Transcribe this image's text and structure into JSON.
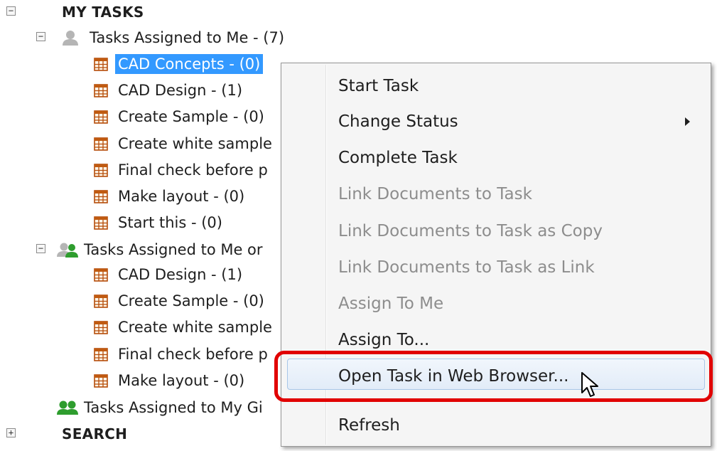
{
  "tree": {
    "my_tasks": {
      "label": "MY TASKS",
      "expander": "−"
    },
    "assigned_to_me": {
      "label": "Tasks Assigned to Me - (7)",
      "expander": "−",
      "items": [
        "CAD Concepts - (0)",
        "CAD Design - (1)",
        "Create Sample - (0)",
        "Create white sample",
        "Final check before p",
        "Make layout - (0)",
        "Start this - (0)"
      ]
    },
    "assigned_to_me_or": {
      "label": "Tasks Assigned to Me or",
      "expander": "−",
      "items": [
        "CAD Design - (1)",
        "Create Sample - (0)",
        "Create white sample",
        "Final check before p",
        "Make layout - (0)"
      ]
    },
    "assigned_to_group": {
      "label": "Tasks Assigned to My Gi"
    },
    "search": {
      "label": "SEARCH",
      "expander": "+"
    }
  },
  "context_menu": {
    "items": [
      {
        "label": "Start Task",
        "enabled": true
      },
      {
        "label": "Change Status",
        "enabled": true,
        "submenu": true
      },
      {
        "label": "Complete Task",
        "enabled": true
      },
      {
        "label": "Link Documents to Task",
        "enabled": false
      },
      {
        "label": "Link Documents to Task as Copy",
        "enabled": false
      },
      {
        "label": "Link Documents to Task as Link",
        "enabled": false
      },
      {
        "label": "Assign To Me",
        "enabled": false
      },
      {
        "label": "Assign To...",
        "enabled": true
      },
      {
        "label": "Open Task in Web Browser...",
        "enabled": true,
        "hovered": true
      },
      {
        "label": "Refresh",
        "enabled": true
      }
    ]
  },
  "colors": {
    "selection": "#3399ff",
    "highlight_outline": "#e10000",
    "calendar_icon": "#c05a10",
    "group_icon": "#2e9d2e",
    "person_icon": "#b5b5b5",
    "disabled_text": "#8d8d8d"
  }
}
